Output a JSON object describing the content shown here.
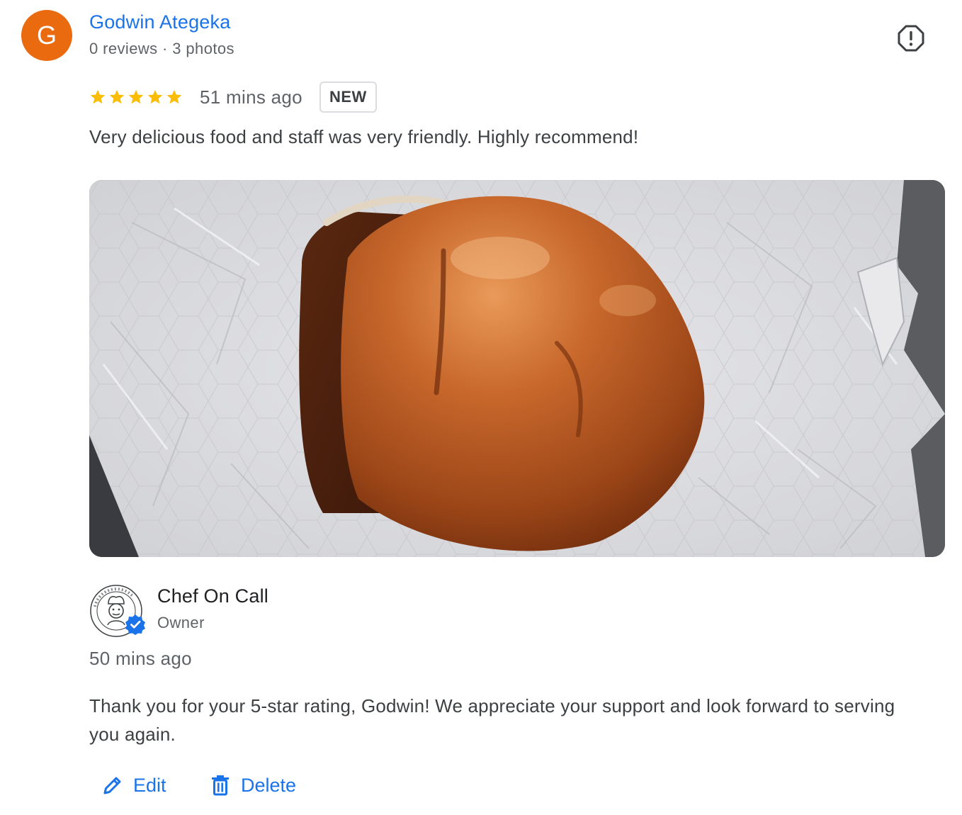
{
  "reviewer": {
    "initial": "G",
    "avatar_color": "#ea6a10",
    "name": "Godwin Ategeka",
    "meta": "0 reviews · 3 photos"
  },
  "review": {
    "rating": 5,
    "rating_max": 5,
    "star_color": "#fbbc04",
    "time_ago": "51 mins ago",
    "badge": "NEW",
    "text": "Very delicious food and staff was very friendly. Highly recommend!"
  },
  "photo": {
    "subject": "burger on crumpled paper wrapper"
  },
  "owner_response": {
    "name": "Chef On Call",
    "role": "Owner",
    "logo_text": "CHEF ON CALL",
    "time_ago": "50 mins ago",
    "text": "Thank you for your 5-star rating, Godwin! We appreciate your support and look forward to serving you again."
  },
  "actions": {
    "edit_label": "Edit",
    "delete_label": "Delete"
  },
  "colors": {
    "link_blue": "#1a73e8",
    "verified_blue": "#1a73e8"
  }
}
